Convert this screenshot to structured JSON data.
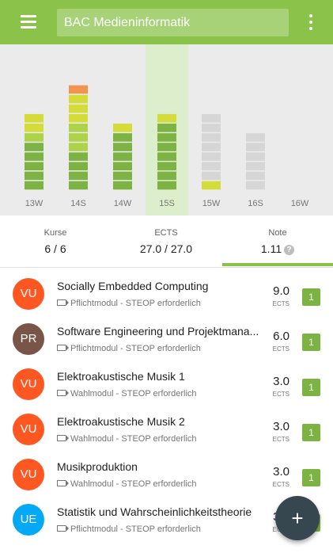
{
  "app_bar": {
    "title": "BAC Medieninformatik",
    "menu_icon": "menu-icon",
    "more_icon": "more-vert-icon"
  },
  "colors": {
    "primary": "#8bc34a",
    "dark_green": "#7cb342",
    "light_green": "#aed24a",
    "yellow": "#d4dc3a",
    "orange": "#f0944e",
    "planned_grey": "#d6d6d6",
    "highlight": "#dceecb",
    "fab": "#37474f"
  },
  "chart_data": {
    "type": "bar",
    "stacked": true,
    "categories": [
      "13W",
      "14S",
      "14W",
      "15S",
      "15W",
      "16S",
      "16W"
    ],
    "selected_category": "15S",
    "series": [
      {
        "values": [
          5,
          4,
          6,
          7,
          0,
          0,
          0
        ],
        "color": "#7cb342"
      },
      {
        "values": [
          1,
          3,
          0,
          0,
          0,
          0,
          0
        ],
        "color": "#aed24a"
      },
      {
        "values": [
          2,
          3,
          1,
          1,
          1,
          0,
          0
        ],
        "color": "#d4dc3a"
      },
      {
        "values": [
          0,
          1,
          0,
          0,
          0,
          0,
          0
        ],
        "color": "#f0944e"
      },
      {
        "values": [
          0,
          0,
          0,
          0,
          7,
          6,
          0
        ],
        "color": "#d6d6d6"
      }
    ],
    "ylim": [
      0,
      13
    ]
  },
  "summary": {
    "kurse_label": "Kurse",
    "kurse_value": "6 / 6",
    "ects_label": "ECTS",
    "ects_value": "27.0 / 27.0",
    "note_label": "Note",
    "note_value": "1.11",
    "help_icon_glyph": "?"
  },
  "courses": [
    {
      "type": "VU",
      "avatar_color": "#ff5722",
      "title": "Socially Embedded Computing",
      "subtitle": "Pflichtmodul - STEOP erforderlich",
      "ects": "9.0",
      "ects_label": "ECTS",
      "grade": "1"
    },
    {
      "type": "PR",
      "avatar_color": "#795548",
      "title": "Software Engineering und Projektmana...",
      "subtitle": "Pflichtmodul - STEOP erforderlich",
      "ects": "6.0",
      "ects_label": "ECTS",
      "grade": "1"
    },
    {
      "type": "VU",
      "avatar_color": "#ff5722",
      "title": "Elektroakustische Musik 1",
      "subtitle": "Wahlmodul - STEOP erforderlich",
      "ects": "3.0",
      "ects_label": "ECTS",
      "grade": "1"
    },
    {
      "type": "VU",
      "avatar_color": "#ff5722",
      "title": "Elektroakustische Musik 2",
      "subtitle": "Wahlmodul - STEOP erforderlich",
      "ects": "3.0",
      "ects_label": "ECTS",
      "grade": "1"
    },
    {
      "type": "VU",
      "avatar_color": "#ff5722",
      "title": "Musikproduktion",
      "subtitle": "Wahlmodul - STEOP erforderlich",
      "ects": "3.0",
      "ects_label": "ECTS",
      "grade": "1"
    },
    {
      "type": "UE",
      "avatar_color": "#03a9f4",
      "title": "Statistik und Wahrscheinlichkeitstheorie",
      "subtitle": "Pflichtmodul - STEOP erforderlich",
      "ects": "3.0",
      "ects_label": "ECTS",
      "grade": "1"
    }
  ],
  "fab": {
    "label": "+",
    "icon": "add-icon"
  }
}
